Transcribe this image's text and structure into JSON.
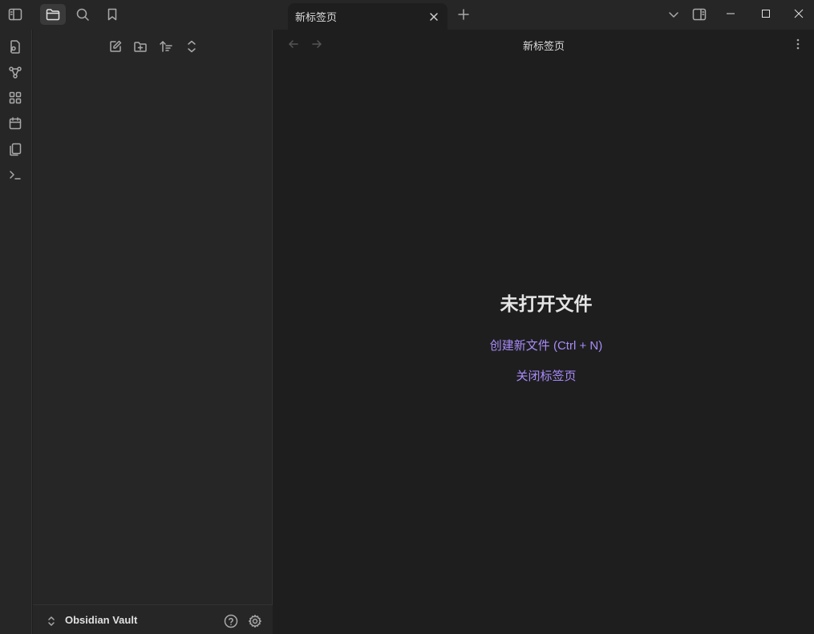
{
  "window": {
    "tab_title": "新标签页",
    "pane_title": "新标签页"
  },
  "empty_state": {
    "title": "未打开文件",
    "create_link": "创建新文件 (Ctrl + N)",
    "close_link": "关闭标签页"
  },
  "vault": {
    "name": "Obsidian Vault"
  },
  "icons": {
    "sidebar_toggle": "sidebar-left-icon",
    "files": "folder-icon",
    "search": "search-icon",
    "bookmarks": "bookmark-icon",
    "tab_close": "x-icon",
    "new_tab": "plus-icon",
    "tab_list": "chevron-down-icon",
    "right_sidebar": "sidebar-right-icon",
    "ribbon": [
      "open-quick-switcher-icon",
      "graph-icon",
      "canvas-icon",
      "daily-note-icon",
      "templates-icon",
      "command-palette-icon"
    ],
    "file_actions": [
      "new-note-icon",
      "new-folder-icon",
      "sort-icon",
      "collapse-all-icon"
    ]
  },
  "colors": {
    "background": "#1e1e1e",
    "panel": "#262626",
    "accent": "#a88bfa",
    "text": "#dadada"
  }
}
